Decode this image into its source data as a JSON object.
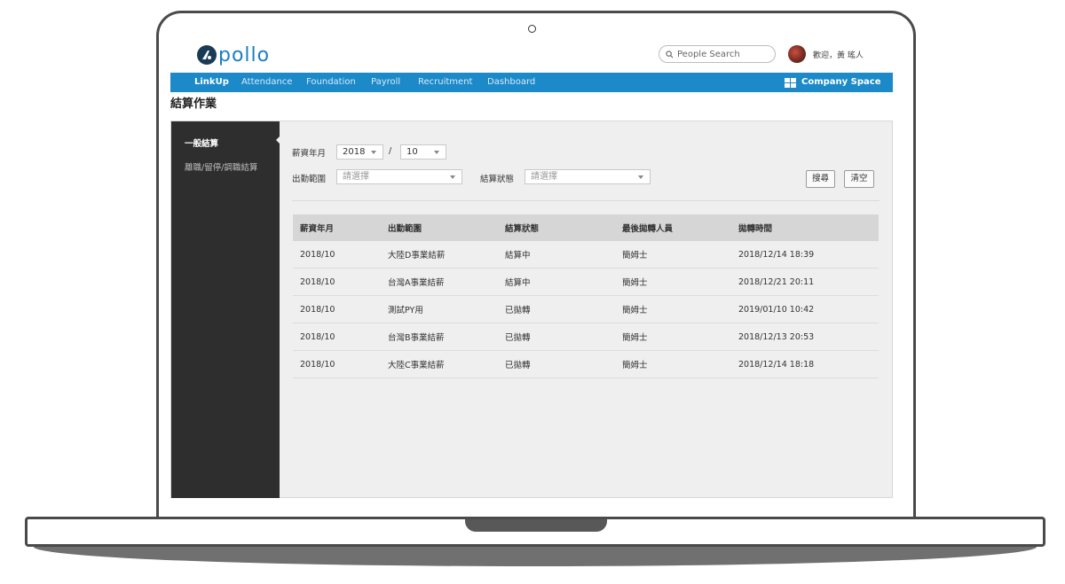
{
  "header": {
    "logo_text": "pollo",
    "search_placeholder": "People Search",
    "welcome_text": "歡迎，黃 瑤人"
  },
  "nav": {
    "items": [
      "LinkUp",
      "Attendance",
      "Foundation",
      "Payroll",
      "Recruitment",
      "Dashboard"
    ],
    "active": "LinkUp",
    "company_space": "Company Space"
  },
  "page": {
    "title": "結算作業"
  },
  "sidebar": {
    "items": [
      {
        "label": "一般結算",
        "active": true
      },
      {
        "label": "離職/留停/調職結算",
        "active": false
      }
    ]
  },
  "filters": {
    "period_label": "薪資年月",
    "year_value": "2018",
    "separator": "/",
    "month_value": "10",
    "range_label": "出勤範圍",
    "range_placeholder": "請選擇",
    "status_label": "結算狀態",
    "status_placeholder": "請選擇",
    "search_button": "搜尋",
    "clear_button": "清空"
  },
  "table": {
    "columns": [
      "薪資年月",
      "出勤範圍",
      "結算狀態",
      "最後拋轉人員",
      "拋轉時間"
    ],
    "rows": [
      [
        "2018/10",
        "大陸D事業結薪",
        "結算中",
        "簡姆士",
        "2018/12/14 18:39"
      ],
      [
        "2018/10",
        "台灣A事業結薪",
        "結算中",
        "簡姆士",
        "2018/12/21 20:11"
      ],
      [
        "2018/10",
        "測試PY用",
        "已拋轉",
        "簡姆士",
        "2019/01/10 10:42"
      ],
      [
        "2018/10",
        "台灣B事業結薪",
        "已拋轉",
        "簡姆士",
        "2018/12/13 20:53"
      ],
      [
        "2018/10",
        "大陸C事業結薪",
        "已拋轉",
        "簡姆士",
        "2018/12/14 18:18"
      ]
    ]
  },
  "colors": {
    "brand_blue": "#1c89c9",
    "sidebar_bg": "#2e2e2e",
    "content_bg": "#efefef",
    "table_header_bg": "#d6d6d6"
  }
}
